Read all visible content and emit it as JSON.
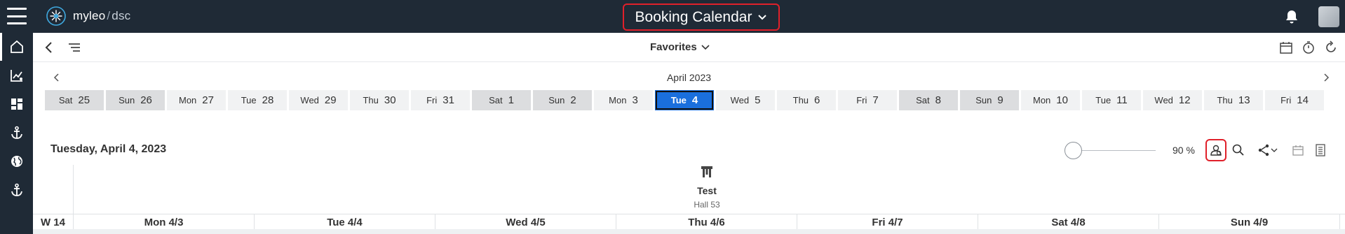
{
  "header": {
    "logo_brand": "myleo",
    "logo_separator": "/",
    "logo_product": "dsc",
    "app_title": "Booking Calendar",
    "icons": [
      "menu-icon",
      "bell-icon",
      "avatar"
    ]
  },
  "sidebar": {
    "items": [
      {
        "icon": "home-icon"
      },
      {
        "icon": "analytics-icon"
      },
      {
        "icon": "dashboard-icon"
      },
      {
        "icon": "anchor-icon"
      },
      {
        "icon": "globe-icon"
      },
      {
        "icon": "anchor-icon"
      }
    ]
  },
  "subbar": {
    "favorites_label": "Favorites"
  },
  "calendar": {
    "month_label": "April 2023",
    "days": [
      {
        "dow": "Sat",
        "num": "25",
        "weekend": true
      },
      {
        "dow": "Sun",
        "num": "26",
        "weekend": true
      },
      {
        "dow": "Mon",
        "num": "27",
        "weekend": false
      },
      {
        "dow": "Tue",
        "num": "28",
        "weekend": false
      },
      {
        "dow": "Wed",
        "num": "29",
        "weekend": false
      },
      {
        "dow": "Thu",
        "num": "30",
        "weekend": false
      },
      {
        "dow": "Fri",
        "num": "31",
        "weekend": false
      },
      {
        "dow": "Sat",
        "num": "1",
        "weekend": true
      },
      {
        "dow": "Sun",
        "num": "2",
        "weekend": true
      },
      {
        "dow": "Mon",
        "num": "3",
        "weekend": false
      },
      {
        "dow": "Tue",
        "num": "4",
        "weekend": false,
        "selected": true
      },
      {
        "dow": "Wed",
        "num": "5",
        "weekend": false
      },
      {
        "dow": "Thu",
        "num": "6",
        "weekend": false
      },
      {
        "dow": "Fri",
        "num": "7",
        "weekend": false
      },
      {
        "dow": "Sat",
        "num": "8",
        "weekend": true
      },
      {
        "dow": "Sun",
        "num": "9",
        "weekend": true
      },
      {
        "dow": "Mon",
        "num": "10",
        "weekend": false
      },
      {
        "dow": "Tue",
        "num": "11",
        "weekend": false
      },
      {
        "dow": "Wed",
        "num": "12",
        "weekend": false
      },
      {
        "dow": "Thu",
        "num": "13",
        "weekend": false
      },
      {
        "dow": "Fri",
        "num": "14",
        "weekend": false
      }
    ],
    "date_heading": "Tuesday, April 4, 2023",
    "zoom_text": "90 %",
    "zoom_level": 0.9
  },
  "resource": {
    "name": "Test",
    "subtitle": "Hall 53"
  },
  "week": {
    "label": "W 14",
    "days": [
      "Mon 4/3",
      "Tue 4/4",
      "Wed 4/5",
      "Thu 4/6",
      "Fri 4/7",
      "Sat 4/8",
      "Sun 4/9"
    ]
  },
  "colors": {
    "topbar": "#1f2a36",
    "accent": "#1a6fdd",
    "highlight": "#e0202a"
  }
}
